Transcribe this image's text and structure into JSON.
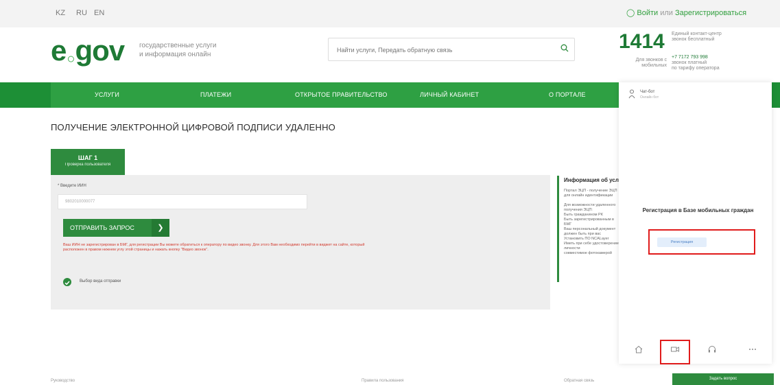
{
  "languages": [
    "KZ",
    "RU",
    "EN"
  ],
  "auth": {
    "login": "Войти",
    "or": "или",
    "register": "Зарегистрироваться"
  },
  "logo": {
    "part1": "e",
    "part2": "gov"
  },
  "tagline": {
    "line1": "государственные услуги",
    "line2": "и информация онлайн"
  },
  "search": {
    "placeholder": "Найти услуги, Передать обратную связь"
  },
  "contact": {
    "number": "1414",
    "note1": "Единый контакт-центр",
    "note2": "звонок бесплатный",
    "note3": "Для звонков с мобильных",
    "note4": "+7 7172 793 998",
    "note5": "звонок платный",
    "note6": "по тарифу оператора"
  },
  "nav": [
    "Услуги",
    "Платежи",
    "Открытое правительство",
    "Личный кабинет",
    "О портале"
  ],
  "page_title": "ПОЛУЧЕНИЕ ЭЛЕКТРОННОЙ ЦИФРОВОЙ ПОДПИСИ УДАЛЕННО",
  "step": {
    "title": "ШАГ 1",
    "subtitle": "Проверка пользователя"
  },
  "form": {
    "iin_label": "* Введите ИИН",
    "iin_value": "9802010000077",
    "send_button": "ОТПРАВИТЬ ЗАПРОС",
    "error": "Ваш ИИН не зарегистрирован в БМГ, для регистрации Вы можете обратиться к оператору по видео звонку. Для этого Вам необходимо перейти в виджет на сайте, который расположен в правом нижнем углу этой страницы и нажать кнопку \"Видео звонок\".",
    "check_label": "Выбор вида отправки"
  },
  "info": {
    "title": "Информация об услуге",
    "text": "Портал ЭЦП - получение ЭЦП для онлайн идентификации\n\nДля возможности удаленного получения ЭЦП:\nБыть гражданином РК\nБыть зарегистрированным в БМГ\nВаш персональный документ должен быть при вас\nУстановить ПО NCALayer\nИметь при себе удостоверение личности\nсовместимое фотокамерой"
  },
  "widget": {
    "agent_name": "Чат-бот",
    "agent_status": "Онлайн бот",
    "reg_title": "Регистрация в Базе мобильных граждан",
    "reg_button": "Регистрация"
  },
  "footer": {
    "link1": "Руководство",
    "link2": "Правила пользования",
    "link3": "Обратная связь",
    "button": "Задать вопрос"
  }
}
